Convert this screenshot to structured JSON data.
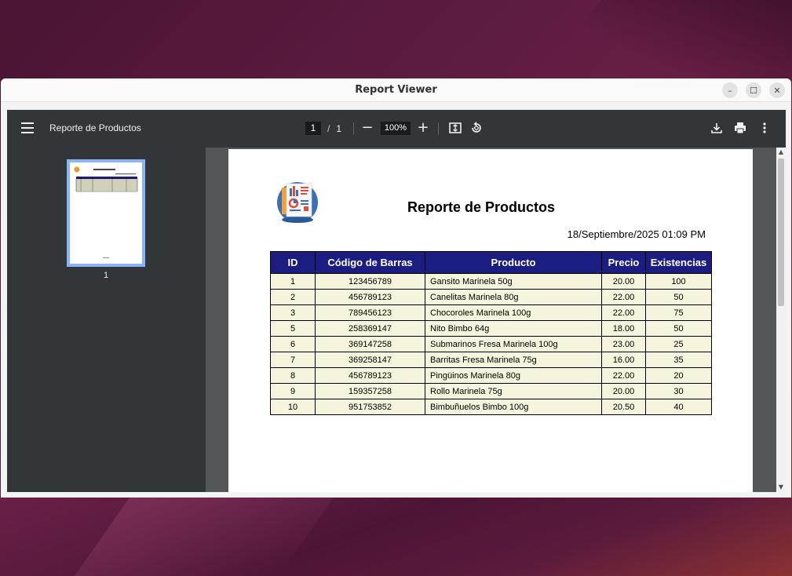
{
  "window": {
    "title": "Report Viewer"
  },
  "viewer": {
    "doc_title": "Reporte de Productos",
    "current_page": "1",
    "page_separator": "/",
    "total_pages": "1",
    "zoom": "100%",
    "thumbnail_label": "1"
  },
  "report": {
    "title": "Reporte de Productos",
    "date": "18/Septiembre/2025 01:09 PM",
    "headers": [
      "ID",
      "Código de Barras",
      "Producto",
      "Precio",
      "Existencias"
    ],
    "rows": [
      [
        "1",
        "123456789",
        "Gansito Marinela 50g",
        "20.00",
        "100"
      ],
      [
        "2",
        "456789123",
        "Canelitas Marinela 80g",
        "22.00",
        "50"
      ],
      [
        "3",
        "789456123",
        "Chocoroles Marinela 100g",
        "22.00",
        "75"
      ],
      [
        "5",
        "258369147",
        "Nito Bimbo 64g",
        "18.00",
        "50"
      ],
      [
        "6",
        "369147258",
        "Submarinos Fresa Marinela 100g",
        "23.00",
        "25"
      ],
      [
        "7",
        "369258147",
        "Barritas Fresa Marinela 75g",
        "16.00",
        "35"
      ],
      [
        "8",
        "456789123",
        "Pingüinos Marinela 80g",
        "22.00",
        "20"
      ],
      [
        "9",
        "159357258",
        "Rollo Marinela 75g",
        "20.00",
        "30"
      ],
      [
        "10",
        "951753852",
        "Bimbuñuelos Bimbo 100g",
        "20.50",
        "40"
      ]
    ]
  },
  "colors": {
    "header_bg": "#1c1d80",
    "row_bg": "#f6f4dc",
    "toolbar": "#323639"
  }
}
